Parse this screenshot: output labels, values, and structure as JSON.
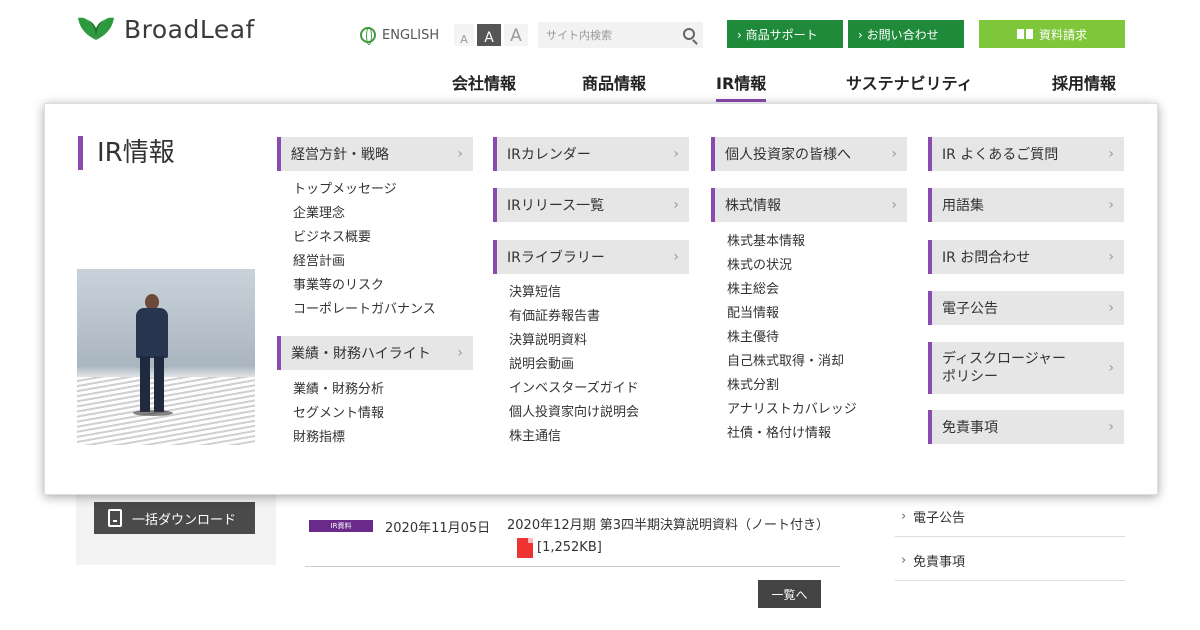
{
  "header": {
    "logo_text": "BroadLeaf",
    "language_label": "ENGLISH",
    "font_sizes": [
      "A",
      "A",
      "A"
    ],
    "search_placeholder": "サイト内検索",
    "support_button": "› 商品サポート",
    "contact_button": "› お問い合わせ",
    "docs_button": "資料請求",
    "colors": {
      "green": "#1f8a3a",
      "light_green": "#7ec63a",
      "accent_purple": "#8a4bb0"
    }
  },
  "global_nav": [
    {
      "label": "会社情報"
    },
    {
      "label": "商品情報"
    },
    {
      "label": "IR情報"
    },
    {
      "label": "サステナビリティ"
    },
    {
      "label": "採用情報"
    }
  ],
  "mega_menu": {
    "title": "IR情報",
    "col1": {
      "cat1": "経営方針・戦略",
      "cat1_items": [
        "トップメッセージ",
        "企業理念",
        "ビジネス概要",
        "経営計画",
        "事業等のリスク",
        "コーポレートガバナンス"
      ],
      "cat2": "業績・財務ハイライト",
      "cat2_items": [
        "業績・財務分析",
        "セグメント情報",
        "財務指標"
      ]
    },
    "col2": {
      "cat1": "IRカレンダー",
      "cat2": "IRリリース一覧",
      "cat3": "IRライブラリー",
      "cat3_items": [
        "決算短信",
        "有価証券報告書",
        "決算説明資料",
        "説明会動画",
        "インベスターズガイド",
        "個人投資家向け説明会",
        "株主通信"
      ]
    },
    "col3": {
      "cat1": "個人投資家の皆様へ",
      "cat2": "株式情報",
      "cat2_items": [
        "株式基本情報",
        "株式の状況",
        "株主総会",
        "配当情報",
        "株主優待",
        "自己株式取得・消却",
        "株式分割",
        "アナリストカバレッジ",
        "社債・格付け情報"
      ]
    },
    "col4": [
      "IR よくあるご質問",
      "用語集",
      "IR お問合わせ",
      "電子公告",
      "ディスクロージャー\nポリシー",
      "免責事項"
    ]
  },
  "background": {
    "download_button": "一括ダウンロード",
    "news": {
      "badge": "IR資料",
      "date": "2020年11月05日",
      "title": "2020年12月期 第3四半期決算説明資料（ノート付き）",
      "size": "[1,252KB]"
    },
    "more_button": "一覧へ",
    "side_links": [
      "電子公告",
      "免責事項"
    ]
  }
}
